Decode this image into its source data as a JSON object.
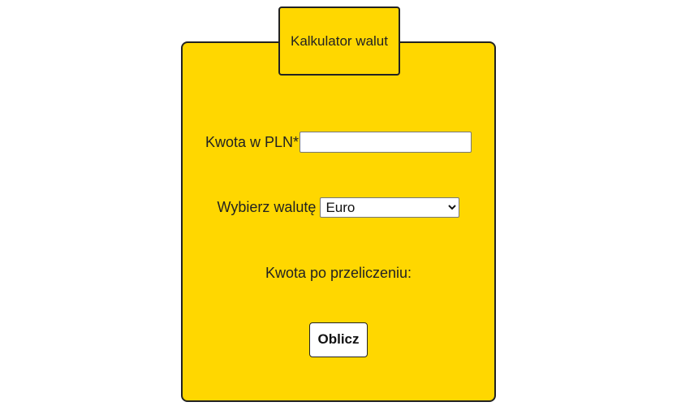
{
  "header": {
    "title": "Kalkulator walut"
  },
  "form": {
    "amount_label": "Kwota w PLN*",
    "amount_value": "",
    "currency_label": "Wybierz walutę",
    "currency_selected": "Euro",
    "result_label": "Kwota po przeliczeniu:",
    "result_value": "",
    "submit_label": "Oblicz"
  },
  "colors": {
    "card_background": "#FFD700",
    "border": "#222222",
    "page_background": "#ffffff"
  }
}
